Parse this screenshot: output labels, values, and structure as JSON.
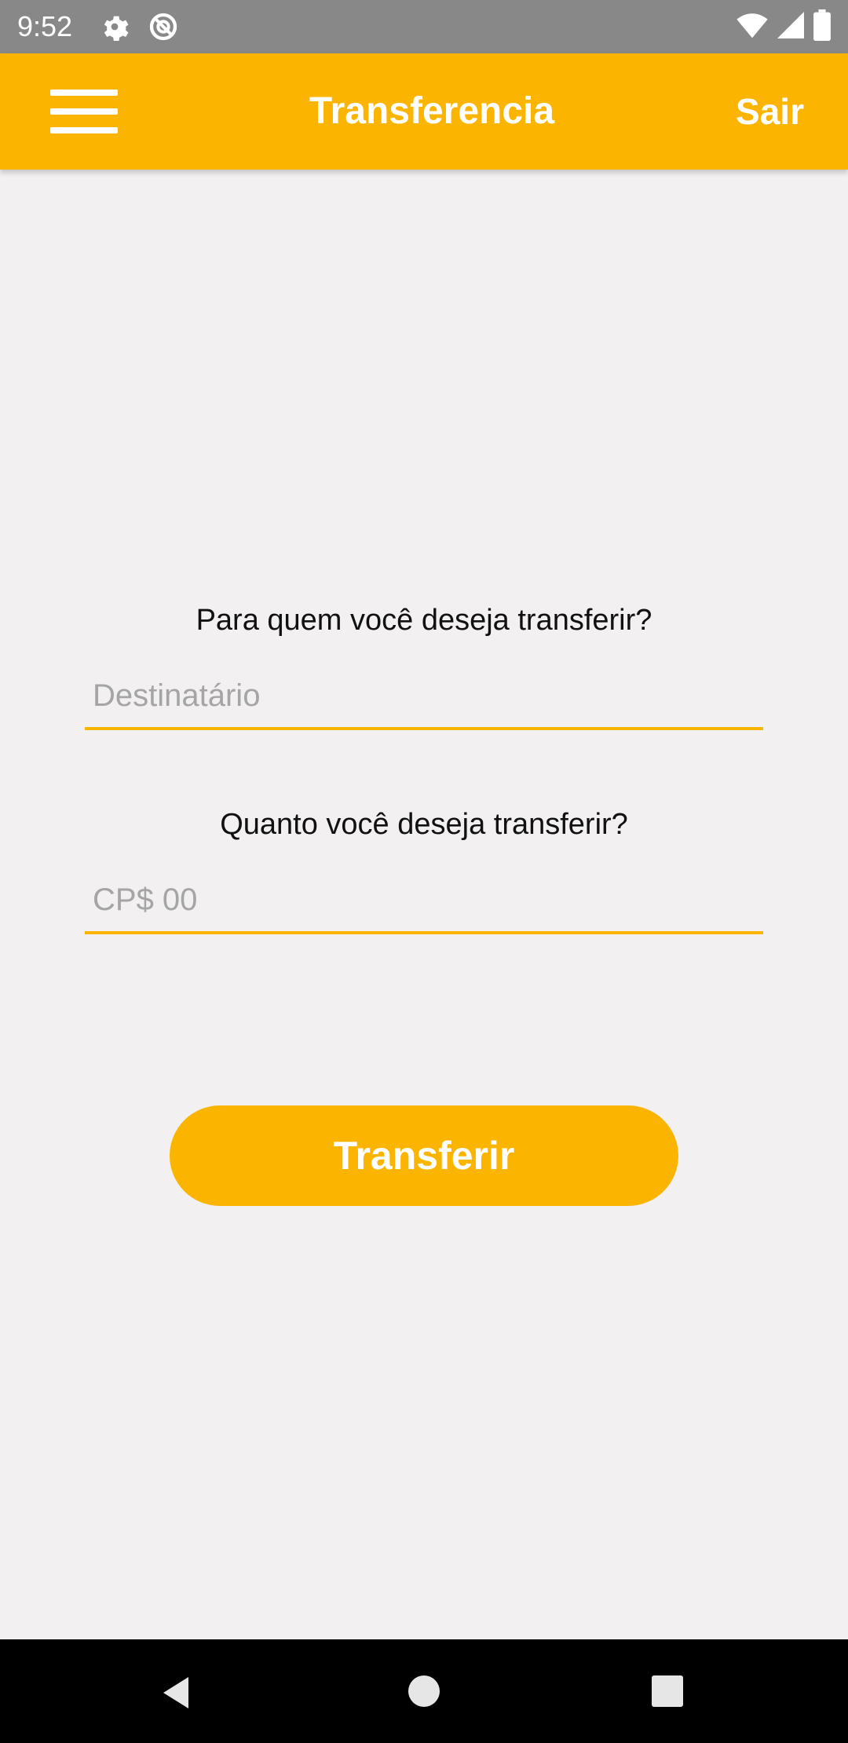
{
  "status_bar": {
    "time": "9:52",
    "icons": [
      "gear-icon",
      "do-not-disturb-icon",
      "wifi-icon",
      "signal-icon",
      "battery-icon"
    ]
  },
  "app_bar": {
    "title": "Transferencia",
    "logout_label": "Sair",
    "menu_icon": "hamburger-menu-icon",
    "color": "#fbb500"
  },
  "form": {
    "recipient_question": "Para quem você deseja transferir?",
    "recipient_placeholder": "Destinatário",
    "recipient_value": "",
    "amount_question": "Quanto você deseja transferir?",
    "amount_placeholder": "CP$ 00",
    "amount_value": "",
    "submit_label": "Transferir"
  },
  "nav_bar": {
    "icons": [
      "back-icon",
      "home-icon",
      "recents-icon"
    ]
  },
  "colors": {
    "accent": "#fbb500",
    "background": "#f2f0f0",
    "status_bar": "#888888",
    "nav_bar": "#000000"
  }
}
